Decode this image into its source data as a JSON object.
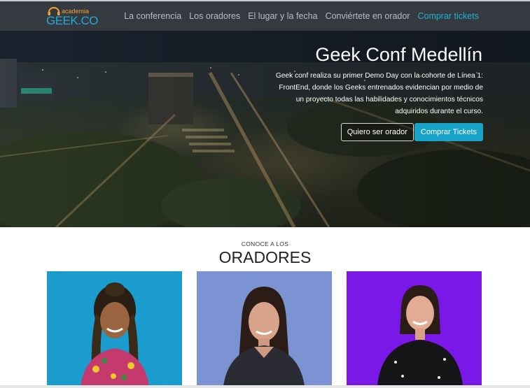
{
  "brand": {
    "small": "academia",
    "main": "GEEK.CO"
  },
  "nav": {
    "items": [
      {
        "label": "La conferencia"
      },
      {
        "label": "Los oradores"
      },
      {
        "label": "El lugar y la fecha"
      },
      {
        "label": "Conviértete en orador"
      },
      {
        "label": "Comprar tickets"
      }
    ]
  },
  "hero": {
    "title": "Geek Conf Medellín",
    "text": "Geek conf realiza su primer Demo Day con la cohorte de Línea 1: FrontEnd, donde los Geeks entrenados evidencian por medio de un proyecto todas las habilidades y conocimientos técnicos adquiridos durante el curso.",
    "btn_speaker": "Quiero ser orador",
    "btn_tickets": "Comprar Tickets"
  },
  "speakers": {
    "kicker": "CONOCE A LOS",
    "title": "ORADORES",
    "cards": [
      {
        "bg": "#1a9ccf"
      },
      {
        "bg": "#7b93d3"
      },
      {
        "bg": "#7a18e8"
      }
    ]
  },
  "colors": {
    "navbar": "#343a40",
    "accent": "#17a2c8"
  }
}
